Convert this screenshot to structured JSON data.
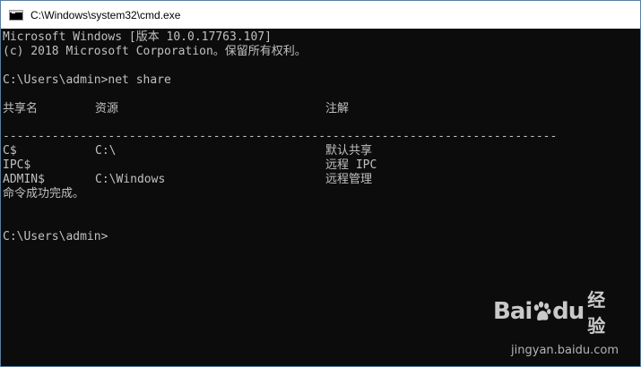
{
  "window": {
    "title": "C:\\Windows\\system32\\cmd.exe",
    "icon": "console-icon"
  },
  "console": {
    "version_line": "Microsoft Windows [版本 10.0.17763.107]",
    "copyright_line": "(c) 2018 Microsoft Corporation。保留所有权利。",
    "prompt_command": "C:\\Users\\admin>net share",
    "headers": {
      "share_name": "共享名",
      "resource": "资源",
      "remark": "注解"
    },
    "separator": "-------------------------------------------------------------------------------",
    "shares": [
      {
        "name": "C$",
        "resource": "C:\\",
        "remark": "默认共享"
      },
      {
        "name": "IPC$",
        "resource": "",
        "remark": "远程 IPC"
      },
      {
        "name": "ADMIN$",
        "resource": "C:\\Windows",
        "remark": "远程管理"
      }
    ],
    "status": "命令成功完成。",
    "prompt": "C:\\Users\\admin>"
  },
  "watermark": {
    "brand_a": "Bai",
    "brand_b": "du",
    "product": "经验",
    "url": "jingyan.baidu.com"
  },
  "colors": {
    "console_bg": "#0c0c0c",
    "console_fg": "#c0c0c0",
    "titlebar_bg": "#ffffff",
    "border": "#3a86c8"
  }
}
